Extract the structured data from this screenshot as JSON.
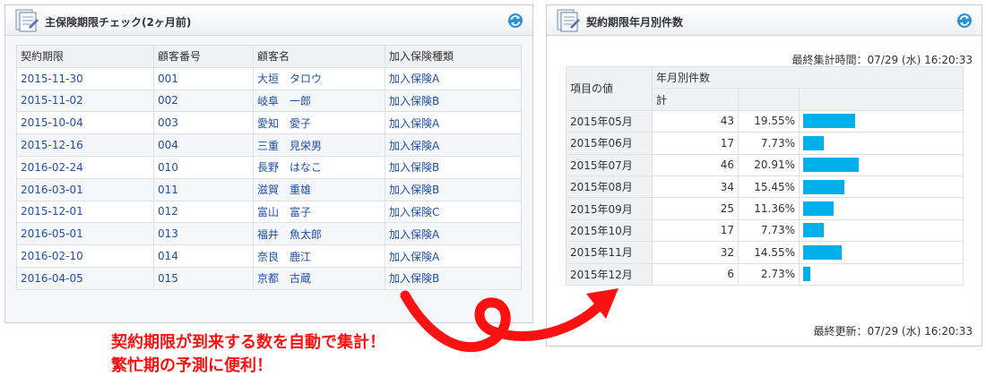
{
  "left_panel": {
    "title": "主保険期限チェック(2ヶ月前)",
    "columns": [
      "契約期限",
      "顧客番号",
      "顧客名",
      "加入保険種類"
    ],
    "rows": [
      [
        "2015-11-30",
        "001",
        "大垣　タロウ",
        "加入保険A"
      ],
      [
        "2015-11-02",
        "002",
        "岐阜　一郎",
        "加入保険B"
      ],
      [
        "2015-10-04",
        "003",
        "愛知　愛子",
        "加入保険A"
      ],
      [
        "2015-12-16",
        "004",
        "三重　見栄男",
        "加入保険A"
      ],
      [
        "2016-02-24",
        "010",
        "長野　はなこ",
        "加入保険B"
      ],
      [
        "2016-03-01",
        "011",
        "滋賀　重雄",
        "加入保険B"
      ],
      [
        "2015-12-01",
        "012",
        "富山　富子",
        "加入保険C"
      ],
      [
        "2016-05-01",
        "013",
        "福井　魚太郎",
        "加入保険A"
      ],
      [
        "2016-02-10",
        "014",
        "奈良　鹿江",
        "加入保険A"
      ],
      [
        "2016-04-05",
        "015",
        "京都　古蔵",
        "加入保険B"
      ]
    ]
  },
  "right_panel": {
    "title": "契約期限年月別件数",
    "last_aggregated": "最終集計時間：07/29 (水) 16:20:33",
    "header_item": "項目の値",
    "header_group": "年月別件数",
    "header_sub": "計",
    "rows": [
      {
        "month": "2015年05月",
        "count": 43,
        "count_label": "43",
        "pct": "19.55%"
      },
      {
        "month": "2015年06月",
        "count": 17,
        "count_label": "17",
        "pct": "7.73%"
      },
      {
        "month": "2015年07月",
        "count": 46,
        "count_label": "46",
        "pct": "20.91%"
      },
      {
        "month": "2015年08月",
        "count": 34,
        "count_label": "34",
        "pct": "15.45%"
      },
      {
        "month": "2015年09月",
        "count": 25,
        "count_label": "25",
        "pct": "11.36%"
      },
      {
        "month": "2015年10月",
        "count": 17,
        "count_label": "17",
        "pct": "7.73%"
      },
      {
        "month": "2015年11月",
        "count": 32,
        "count_label": "32",
        "pct": "14.55%"
      },
      {
        "month": "2015年12月",
        "count": 6,
        "count_label": "6",
        "pct": "2.73%"
      }
    ],
    "bar_max": 46,
    "bar_color": "#00aee8",
    "last_updated": "最終更新：07/29 (水) 16:20:33"
  },
  "annotation": {
    "line1": "契約期限が到来する数を自動で集計！",
    "line2": "繁忙期の予測に便利！",
    "color": "#ff1111"
  },
  "icons": [
    "document-icon",
    "refresh-icon",
    "curved-arrow-icon"
  ]
}
